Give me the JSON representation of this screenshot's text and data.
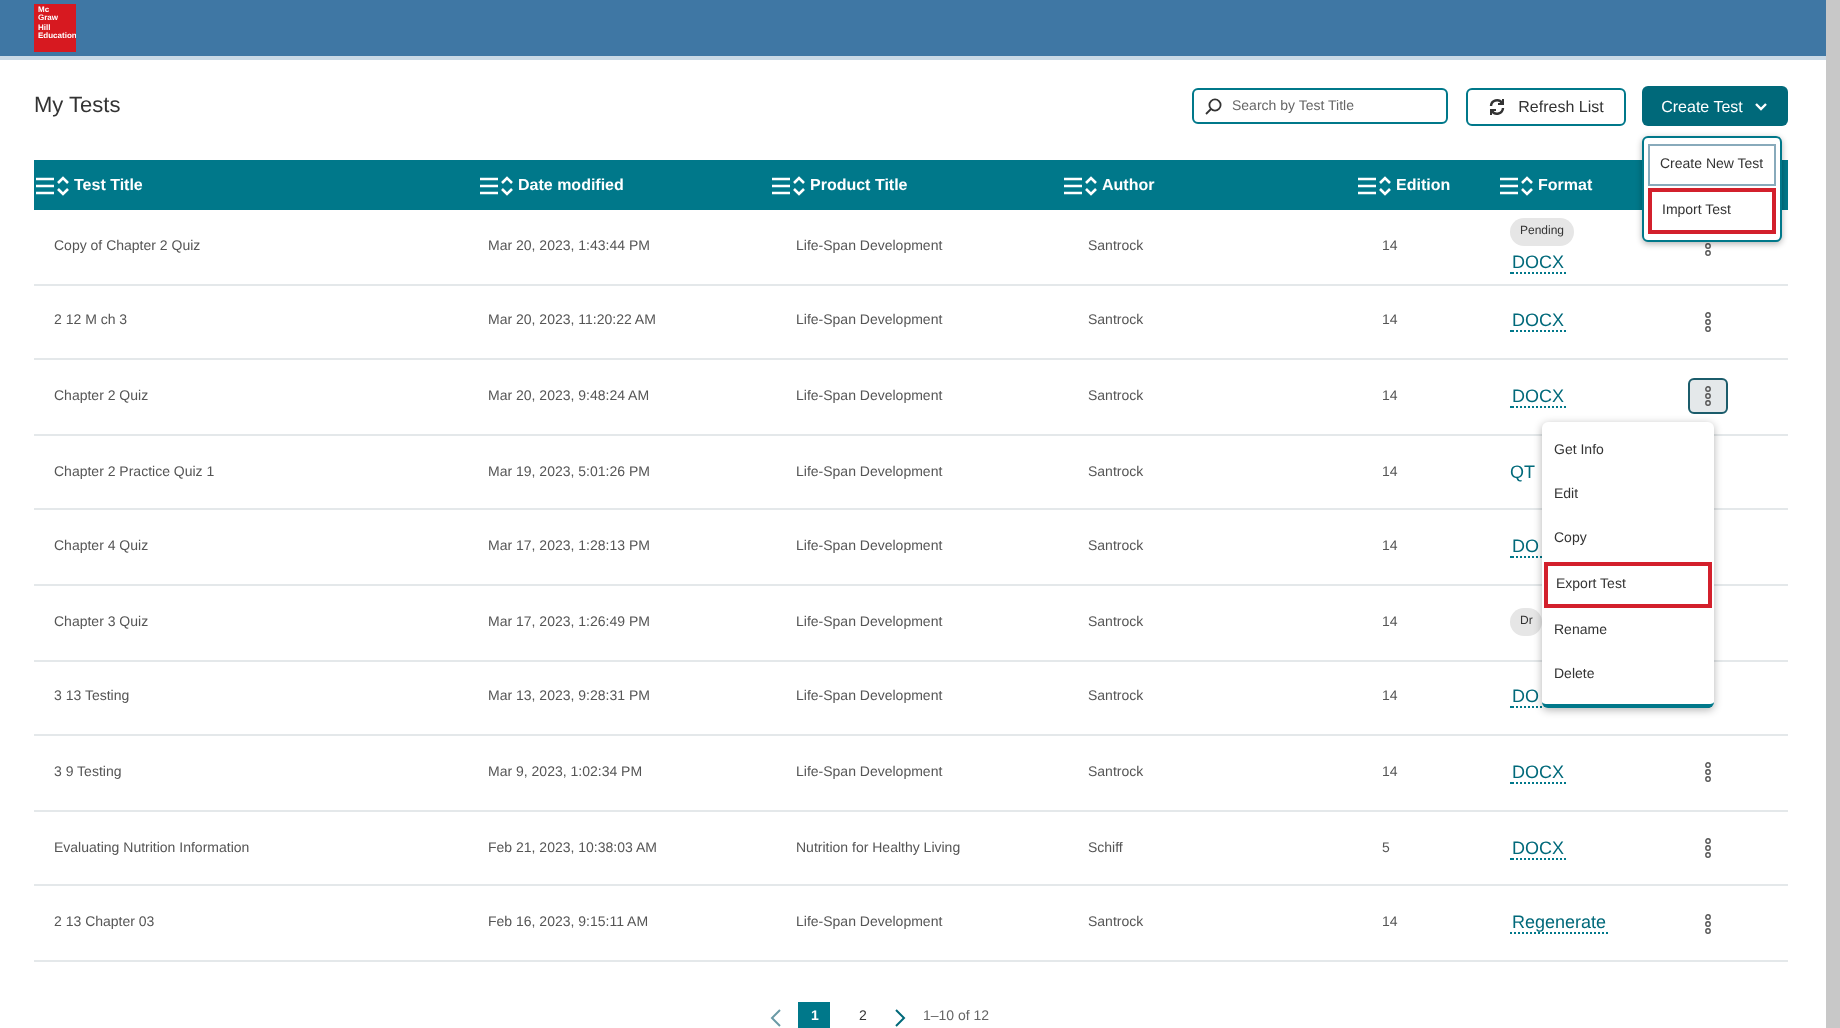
{
  "header": {
    "logo_text": [
      "Mc",
      "Graw",
      "Hill",
      "Education"
    ]
  },
  "page_title": "My Tests",
  "search": {
    "placeholder": "Search by Test Title"
  },
  "refresh_button": "Refresh List",
  "create_button": {
    "label": "Create Test",
    "expanded": true,
    "menu": [
      {
        "label": "Create New Test",
        "selected": true,
        "highlighted": false
      },
      {
        "label": "Import Test",
        "selected": false,
        "highlighted": true
      }
    ]
  },
  "table": {
    "columns": [
      "Test Title",
      "Date modified",
      "Product Title",
      "Author",
      "Edition",
      "Format"
    ],
    "rows": [
      {
        "title": "Copy of Chapter 2 Quiz",
        "date": "Mar 20, 2023, 1:43:44 PM",
        "product": "Life-Span Development",
        "author": "Santrock",
        "edition": "14",
        "format": [
          {
            "kind": "pill",
            "text": "Pending"
          },
          {
            "kind": "link",
            "text": "DOCX"
          }
        ],
        "selected": false
      },
      {
        "title": "2 12 M ch 3",
        "date": "Mar 20, 2023, 11:20:22 AM",
        "product": "Life-Span Development",
        "author": "Santrock",
        "edition": "14",
        "format": [
          {
            "kind": "link",
            "text": "DOCX"
          }
        ],
        "selected": false
      },
      {
        "title": "Chapter 2 Quiz",
        "date": "Mar 20, 2023, 9:48:24 AM",
        "product": "Life-Span Development",
        "author": "Santrock",
        "edition": "14",
        "format": [
          {
            "kind": "link",
            "text": "DOCX"
          }
        ],
        "selected": true
      },
      {
        "title": "Chapter 2 Practice Quiz 1",
        "date": "Mar 19, 2023, 5:01:26 PM",
        "product": "Life-Span Development",
        "author": "Santrock",
        "edition": "14",
        "format": [
          {
            "kind": "plain",
            "text": "QT"
          }
        ],
        "selected": false
      },
      {
        "title": "Chapter 4 Quiz",
        "date": "Mar 17, 2023, 1:28:13 PM",
        "product": "Life-Span Development",
        "author": "Santrock",
        "edition": "14",
        "format": [
          {
            "kind": "link",
            "text": "DO"
          }
        ],
        "selected": false
      },
      {
        "title": "Chapter 3 Quiz",
        "date": "Mar 17, 2023, 1:26:49 PM",
        "product": "Life-Span Development",
        "author": "Santrock",
        "edition": "14",
        "format": [
          {
            "kind": "pill",
            "text": "Dr"
          }
        ],
        "selected": false
      },
      {
        "title": "3 13 Testing",
        "date": "Mar 13, 2023, 9:28:31 PM",
        "product": "Life-Span Development",
        "author": "Santrock",
        "edition": "14",
        "format": [
          {
            "kind": "link",
            "text": "DO"
          }
        ],
        "selected": false
      },
      {
        "title": "3 9 Testing",
        "date": "Mar 9, 2023, 1:02:34 PM",
        "product": "Life-Span Development",
        "author": "Santrock",
        "edition": "14",
        "format": [
          {
            "kind": "link",
            "text": "DOCX"
          }
        ],
        "selected": false
      },
      {
        "title": "Evaluating Nutrition Information",
        "date": "Feb 21, 2023, 10:38:03 AM",
        "product": "Nutrition for Healthy Living",
        "author": "Schiff",
        "edition": "5",
        "format": [
          {
            "kind": "link",
            "text": "DOCX"
          }
        ],
        "selected": false
      },
      {
        "title": "2 13 Chapter 03",
        "date": "Feb 16, 2023, 9:15:11 AM",
        "product": "Life-Span Development",
        "author": "Santrock",
        "edition": "14",
        "format": [
          {
            "kind": "link",
            "text": "Regenerate"
          }
        ],
        "selected": false
      }
    ]
  },
  "row_menu": {
    "items": [
      {
        "label": "Get Info",
        "highlighted": false
      },
      {
        "label": "Edit",
        "highlighted": false
      },
      {
        "label": "Copy",
        "highlighted": false
      },
      {
        "label": "Export Test",
        "highlighted": true
      },
      {
        "label": "Rename",
        "highlighted": false
      },
      {
        "label": "Delete",
        "highlighted": false
      }
    ]
  },
  "pagination": {
    "pages": [
      {
        "label": "1",
        "selected": true
      },
      {
        "label": "2",
        "selected": false
      }
    ],
    "range": "1–10 of 12"
  }
}
